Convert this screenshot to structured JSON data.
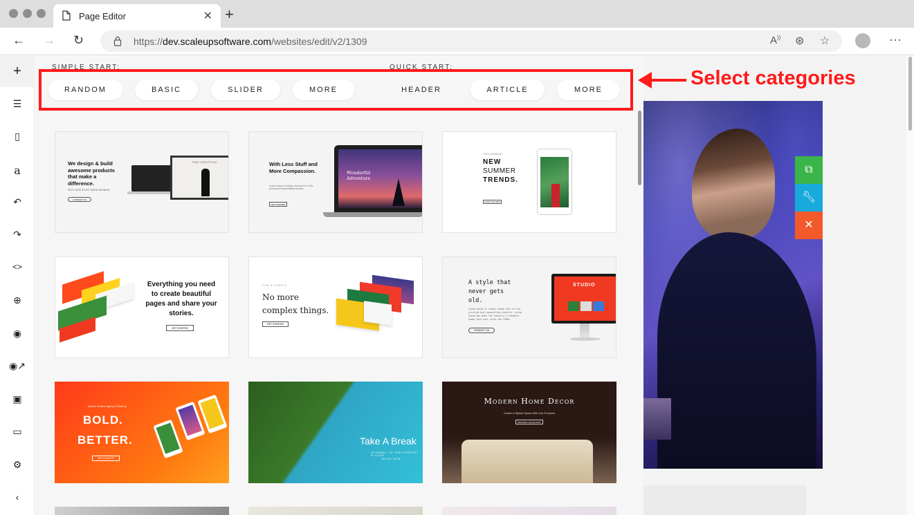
{
  "browser": {
    "tab_title": "Page Editor",
    "url_prefix": "https://",
    "url_host": "dev.scaleupsoftware.com",
    "url_path": "/websites/edit/v2/1309"
  },
  "panel": {
    "simple_label": "SIMPLE START:",
    "quick_label": "QUICK START:",
    "simple_buttons": [
      "RANDOM",
      "BASIC",
      "SLIDER",
      "MORE"
    ],
    "quick_buttons": [
      "HEADER",
      "ARTICLE",
      "MORE"
    ]
  },
  "callout": {
    "text": "Select categories",
    "color": "#ff1a1a"
  },
  "templates": {
    "t1": {
      "headline": "We design & build awesome products that make a difference.",
      "sub": "WITH LESS STUFF, MORE MEANING",
      "button": "CONTACT US",
      "screen_text": "FIND YOUR STYLE"
    },
    "t2": {
      "headline": "With Less Stuff and More Compassion.",
      "sub": "Lorem Ipsum is simply dummy text of the printing and typesetting industry.",
      "button": "GET STARTED",
      "screen_text": "Wonderful Adventure"
    },
    "t3": {
      "overline": "THE LOOKBOOK",
      "line1": "NEW",
      "line2": "SUMMER",
      "line3": "TRENDS.",
      "button": "LOOK GALLERY"
    },
    "t4": {
      "headline": "Everything you need to create beautiful pages and share your stories.",
      "button": "GET STARTED"
    },
    "t5": {
      "overline": "FUN & SIMPLE",
      "headline": "No more complex things.",
      "button": "GET STARTED"
    },
    "t6": {
      "headline": "A style that never gets old.",
      "sub": "Lorem Ipsum is simply dummy text of the printing and typesetting industry. Lorem Ipsum has been the industry's standard dummy text ever since the 1500s.",
      "button": "CONTACT US",
      "screen_text": "STUDIO"
    },
    "t7": {
      "overline": "Modern Creative Agency & Start-Up",
      "line1": "BOLD.",
      "line2": "BETTER.",
      "button": "GET A QUOTE"
    },
    "t8": {
      "headline": "Take A Break",
      "sub": "GETAWAY TO THE PERFECT PLACES",
      "button": "BOOK NOW"
    },
    "t9": {
      "headline": "Modern Home Decor",
      "sub": "Create a Stylish Space With Our Products",
      "button": "BROWSE COLLECTION"
    }
  },
  "icons": {
    "rail": [
      "plus-icon",
      "menu-icon",
      "page-icon",
      "font-icon",
      "undo-icon",
      "redo-icon",
      "code-icon",
      "zoom-icon",
      "eye-icon",
      "preview-external-icon",
      "save-icon",
      "clipboard-icon",
      "settings-icon",
      "collapse-icon"
    ],
    "float": [
      "duplicate-icon",
      "wrench-icon",
      "close-icon"
    ]
  },
  "colors": {
    "float_green": "#3ab54a",
    "float_blue": "#18a9dd",
    "float_orange": "#f3592a"
  }
}
